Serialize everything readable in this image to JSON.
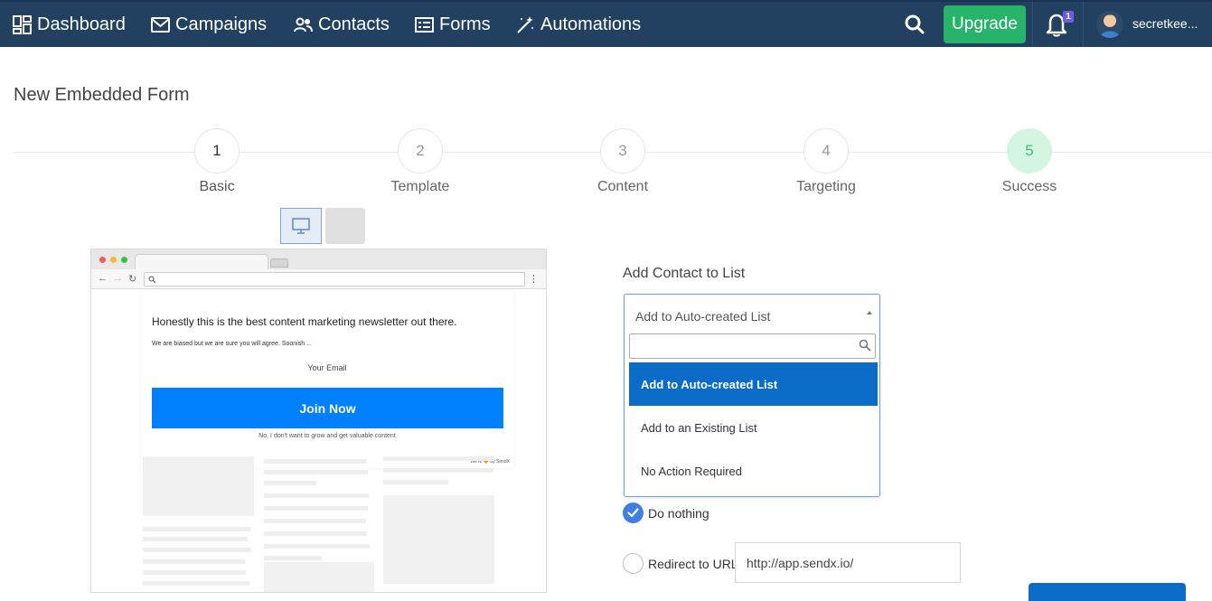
{
  "nav": {
    "items": [
      {
        "label": "Dashboard",
        "icon": "dashboard-icon"
      },
      {
        "label": "Campaigns",
        "icon": "envelope-icon"
      },
      {
        "label": "Contacts",
        "icon": "users-icon"
      },
      {
        "label": "Forms",
        "icon": "form-icon"
      },
      {
        "label": "Automations",
        "icon": "magic-wand-icon"
      }
    ],
    "upgrade_label": "Upgrade",
    "notification_count": "1",
    "username": "secretkee..."
  },
  "page": {
    "title": "New Embedded Form"
  },
  "steps": [
    {
      "number": "1",
      "label": "Basic"
    },
    {
      "number": "2",
      "label": "Template"
    },
    {
      "number": "3",
      "label": "Content"
    },
    {
      "number": "4",
      "label": "Targeting"
    },
    {
      "number": "5",
      "label": "Success"
    }
  ],
  "preview": {
    "headline": "Honestly this is the best content marketing newsletter out there.",
    "subtext": "We are biased but we are sure you will agree. Soonish ...",
    "email_placeholder": "Your Email",
    "button_label": "Join Now",
    "decline_text": "No, I don't want to grow and get valuable content",
    "brand_text": "We're 🧡 by SendX"
  },
  "list_section": {
    "label": "Add Contact to List",
    "selected": "Add to Auto-created List",
    "search_value": "",
    "options": [
      "Add to Auto-created List",
      "Add to an Existing List",
      "No Action Required"
    ]
  },
  "after_submit": {
    "do_nothing_label": "Do nothing",
    "redirect_label": "Redirect to URL",
    "redirect_url": "http://app.sendx.io/"
  },
  "colors": {
    "nav_bg": "#22405f",
    "upgrade": "#27b36a",
    "accent": "#0b6cc7",
    "cta": "#0080ff",
    "step_active_bg": "#d4f5e2",
    "step_active_text": "#3bbf7a"
  }
}
